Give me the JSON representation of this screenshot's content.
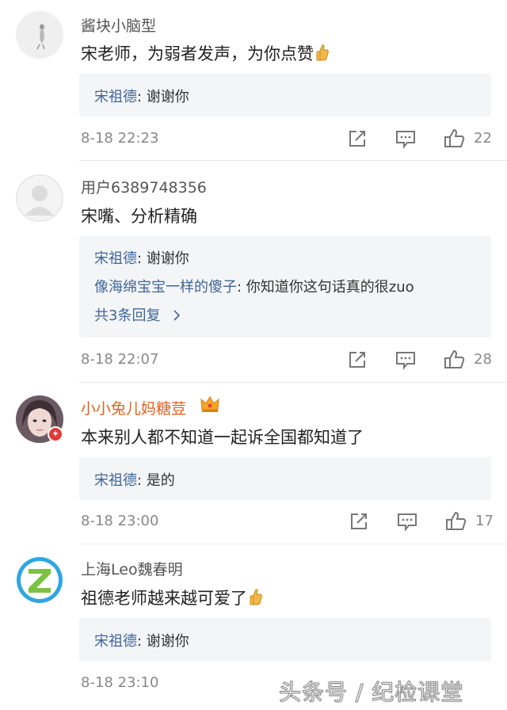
{
  "comments": [
    {
      "username": "酱块小脑型",
      "text": "宋老师，为弱者发声，为你点赞",
      "replies": [
        {
          "user": "宋祖德",
          "text": ": 谢谢你"
        }
      ],
      "time": "8-18 22:23",
      "likes": "22"
    },
    {
      "username": "用户6389748356",
      "text": "宋嘴、分析精确",
      "replies": [
        {
          "user": "宋祖德",
          "text": ": 谢谢你"
        },
        {
          "user": "像海绵宝宝一样的傻子",
          "text": ": 你知道你这句话真的很zuo"
        }
      ],
      "more_replies": "共3条回复",
      "time": "8-18 22:07",
      "likes": "28"
    },
    {
      "username": "小小兔儿妈糖荳",
      "text": "本来别人都不知道一起诉全国都知道了",
      "replies": [
        {
          "user": "宋祖德",
          "text": ": 是的"
        }
      ],
      "time": "8-18 23:00",
      "likes": "17"
    },
    {
      "username": "上海Leo魏春明",
      "text": "祖德老师越来越可爱了",
      "replies": [
        {
          "user": "宋祖德",
          "text": ": 谢谢你"
        }
      ],
      "time": "8-18 23:10",
      "likes": ""
    }
  ],
  "watermark": "头条号 / 纪检课堂",
  "colors": {
    "reply_user": "#406599",
    "vip_name": "#e06020",
    "meta_gray": "#888888",
    "reply_bg": "#f4f5f6"
  }
}
